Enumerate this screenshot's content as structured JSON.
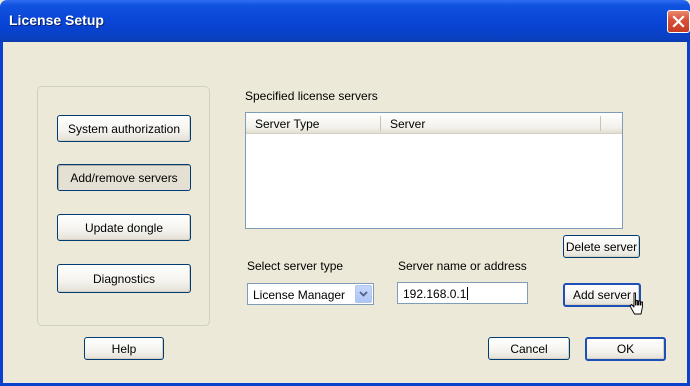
{
  "window": {
    "title": "License Setup"
  },
  "left_panel": {
    "buttons": [
      {
        "label": "System authorization"
      },
      {
        "label": "Add/remove servers"
      },
      {
        "label": "Update dongle"
      },
      {
        "label": "Diagnostics"
      }
    ]
  },
  "servers": {
    "list_label": "Specified license servers",
    "columns": [
      "Server Type",
      "Server"
    ],
    "rows": [],
    "delete_label": "Delete server",
    "add_label": "Add server"
  },
  "server_type": {
    "label": "Select server type",
    "value": "License Manager"
  },
  "server_address": {
    "label": "Server name or address",
    "value": "192.168.0.1"
  },
  "footer": {
    "help_label": "Help",
    "cancel_label": "Cancel",
    "ok_label": "OK"
  },
  "icons": {
    "close": "close-icon",
    "dropdown": "chevron-down-icon",
    "cursor": "mouse-pointer-icon"
  }
}
